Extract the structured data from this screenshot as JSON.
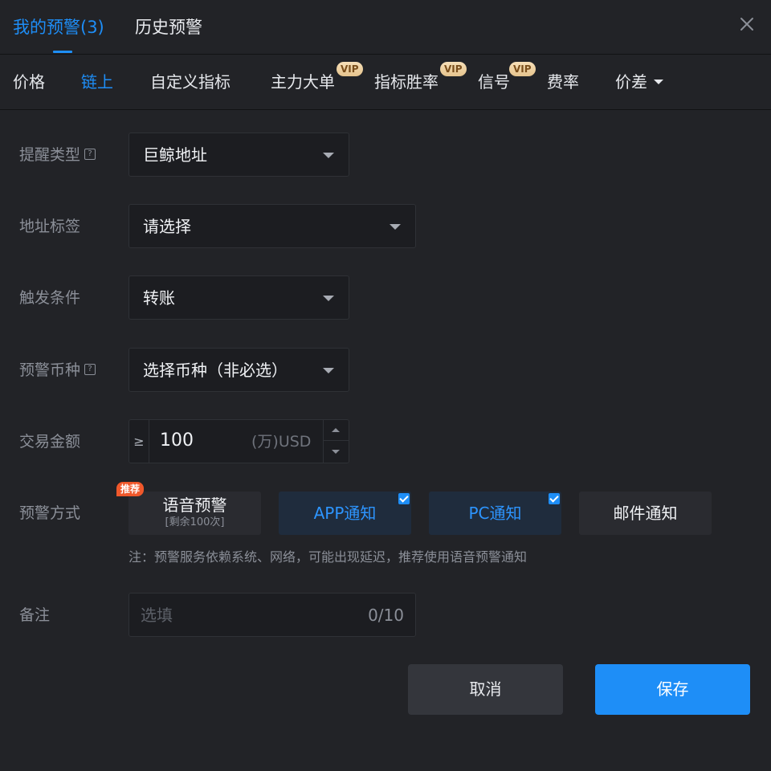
{
  "header": {
    "tab_active": "我的预警(3)",
    "tab_history": "历史预警",
    "close_icon": "close-icon"
  },
  "categories": {
    "items": [
      {
        "label": "价格"
      },
      {
        "label": "链上"
      },
      {
        "label": "自定义指标"
      },
      {
        "label": "主力大单",
        "badge": "VIP"
      },
      {
        "label": "指标胜率",
        "badge": "VIP"
      },
      {
        "label": "信号",
        "badge": "VIP"
      },
      {
        "label": "费率"
      },
      {
        "label": "价差"
      }
    ],
    "active": "链上"
  },
  "form": {
    "reminder_type": {
      "label": "提醒类型",
      "value": "巨鲸地址",
      "help": "?"
    },
    "address_tag": {
      "label": "地址标签",
      "value": "请选择"
    },
    "trigger": {
      "label": "触发条件",
      "value": "转账"
    },
    "coin": {
      "label": "预警币种",
      "value": "选择币种（非必选）",
      "help": "?"
    },
    "amount": {
      "label": "交易金额",
      "operator": "≥",
      "value": "100",
      "unit": "(万)USD"
    },
    "method": {
      "label": "预警方式",
      "badge": "推荐",
      "voice": {
        "label": "语音预警",
        "sub": "[剩余100次]",
        "checked": false
      },
      "app": {
        "label": "APP通知",
        "checked": true
      },
      "pc": {
        "label": "PC通知",
        "checked": true
      },
      "email": {
        "label": "邮件通知",
        "checked": false
      }
    },
    "note": "注：预警服务依赖系统、网络，可能出现延迟，推荐使用语音预警通知",
    "remark": {
      "label": "备注",
      "placeholder": "选填",
      "count": "0/10"
    }
  },
  "buttons": {
    "cancel": "取消",
    "save": "保存"
  },
  "colors": {
    "accent": "#1e8ef7",
    "background": "#222327",
    "vip": "#e6c48d",
    "badge": "#f0582b"
  }
}
